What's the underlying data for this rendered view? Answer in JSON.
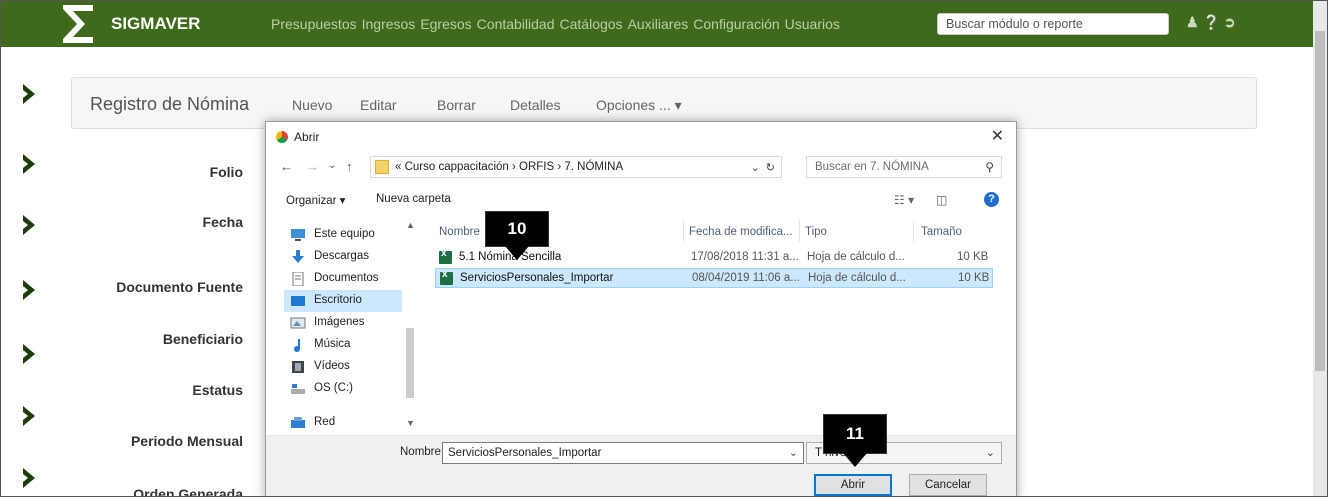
{
  "app": {
    "brand": "SIGMAVER",
    "menu": [
      "Presupuestos",
      "Ingresos",
      "Egresos",
      "Contabilidad",
      "Catálogos",
      "Auxiliares",
      "Configuración",
      "Usuarios"
    ],
    "search_placeholder": "Buscar módulo o reporte"
  },
  "toolbar": {
    "title": "Registro de Nómina",
    "nuevo": "Nuevo",
    "editar": "Editar",
    "borrar": "Borrar",
    "detalles": "Detalles",
    "opciones": "Opciones ... ▾"
  },
  "form": {
    "folio": "Folio",
    "fecha": "Fecha",
    "documento_fuente": "Documento Fuente",
    "beneficiario": "Beneficiario",
    "estatus": "Estatus",
    "periodo_mensual": "Periodo Mensual",
    "orden_generada": "Orden Generada"
  },
  "dialog": {
    "title": "Abrir",
    "path": "«  Curso cappacitación  ›  ORFIS  ›  7. NÓMINA",
    "search_placeholder": "Buscar en 7. NÓMINA",
    "organizar": "Organizar ▾",
    "nueva_carpeta": "Nueva carpeta",
    "nav_items": [
      "Este equipo",
      "Descargas",
      "Documentos",
      "Escritorio",
      "Imágenes",
      "Música",
      "Vídeos",
      "OS (C:)",
      "Red"
    ],
    "selected_nav": "Escritorio",
    "columns": {
      "nombre": "Nombre",
      "fecha": "Fecha de modifica...",
      "tipo": "Tipo",
      "tamano": "Tamaño"
    },
    "files": [
      {
        "name": "5.1 Nómina Sencilla",
        "date": "17/08/2018 11:31 a...",
        "type": "Hoja de cálculo d...",
        "size": "10 KB"
      },
      {
        "name": "ServiciosPersonales_Importar",
        "date": "08/04/2019 11:06 a...",
        "type": "Hoja de cálculo d...",
        "size": "10 KB"
      }
    ],
    "nombre_label": "Nombre:",
    "nombre_value": "ServiciosPersonales_Importar",
    "type_value": "T            hivos",
    "open_button": "Abrir",
    "cancel_button": "Cancelar"
  },
  "badges": {
    "step_10": "10",
    "step_11": "11"
  },
  "colors": {
    "nav_green": "#3f6a1b",
    "selection": "#cce8ff",
    "accent_blue": "#0078d7"
  }
}
